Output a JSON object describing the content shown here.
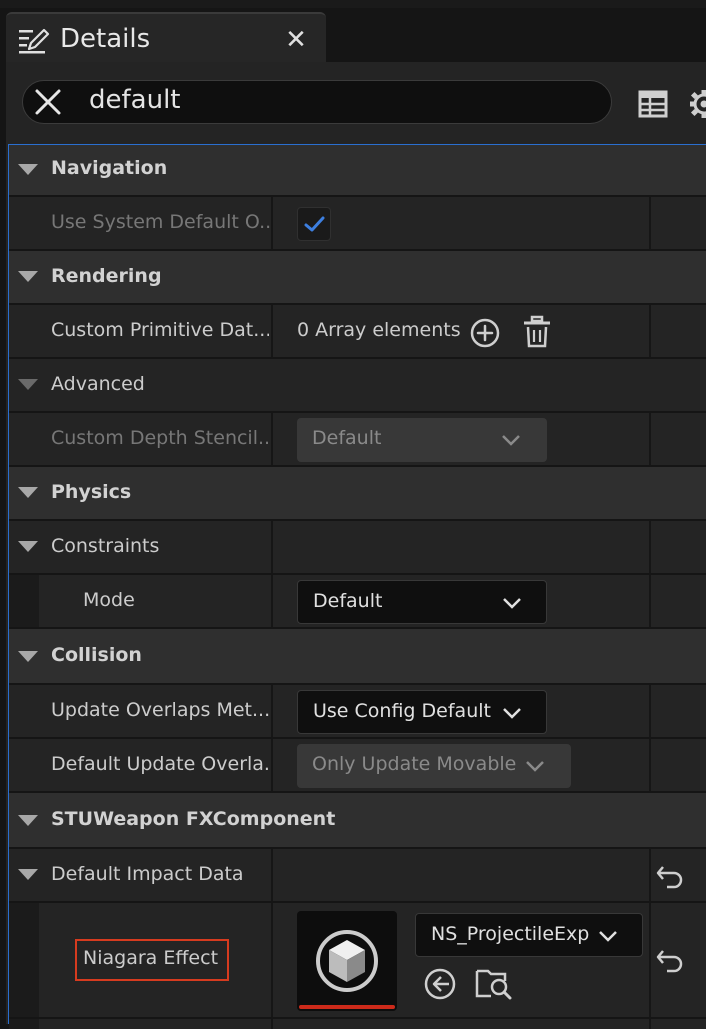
{
  "tab": {
    "title": "Details",
    "close_glyph": "✕",
    "icon": "details-pen-icon"
  },
  "search": {
    "value": "default"
  },
  "toolbar": {
    "icons": [
      "table-view-icon",
      "settings-gear-icon"
    ]
  },
  "sections": {
    "navigation": {
      "label": "Navigation"
    },
    "use_system_default": {
      "label": "Use System Default O...",
      "checked": true
    },
    "rendering": {
      "label": "Rendering"
    },
    "custom_primitive": {
      "label": "Custom Primitive Dat...",
      "value": "0 Array elements"
    },
    "advanced": {
      "label": "Advanced"
    },
    "custom_depth": {
      "label": "Custom Depth Stencil...",
      "value": "Default"
    },
    "physics": {
      "label": "Physics"
    },
    "constraints": {
      "label": "Constraints"
    },
    "mode": {
      "label": "Mode",
      "value": "Default"
    },
    "collision": {
      "label": "Collision"
    },
    "update_overlaps": {
      "label": "Update Overlaps Met...",
      "value": "Use Config Default"
    },
    "default_update_overlaps": {
      "label": "Default Update Overla...",
      "value": "Only Update Movable"
    },
    "stu_weapon": {
      "label": "STUWeapon FXComponent"
    },
    "default_impact": {
      "label": "Default Impact Data"
    },
    "niagara": {
      "label": "Niagara Effect",
      "asset": "NS_ProjectileExp"
    }
  },
  "colors": {
    "accent_blue": "#2a6fd0",
    "highlight_red": "#d63b1f",
    "check_blue": "#3d7fe0"
  }
}
